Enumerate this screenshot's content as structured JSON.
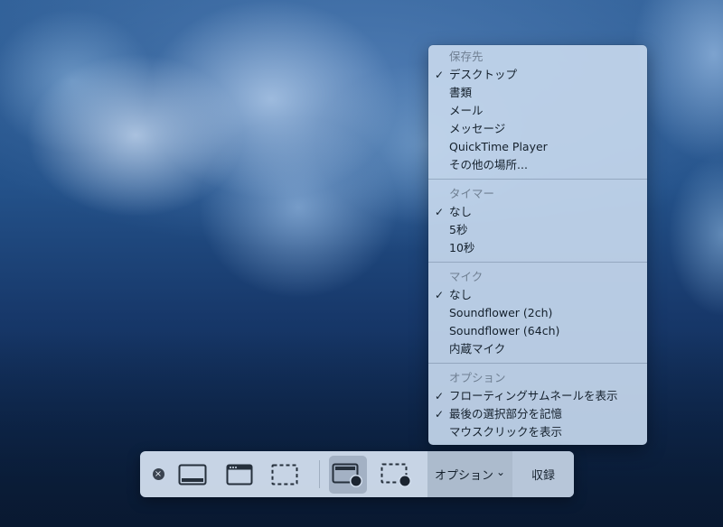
{
  "options_menu": {
    "save_to": {
      "header": "保存先",
      "items": [
        {
          "label": "デスクトップ",
          "checked": true
        },
        {
          "label": "書類",
          "checked": false
        },
        {
          "label": "メール",
          "checked": false
        },
        {
          "label": "メッセージ",
          "checked": false
        },
        {
          "label": "QuickTime Player",
          "checked": false
        },
        {
          "label": "その他の場所...",
          "checked": false
        }
      ]
    },
    "timer": {
      "header": "タイマー",
      "items": [
        {
          "label": "なし",
          "checked": true
        },
        {
          "label": "5秒",
          "checked": false
        },
        {
          "label": "10秒",
          "checked": false
        }
      ]
    },
    "microphone": {
      "header": "マイク",
      "items": [
        {
          "label": "なし",
          "checked": true
        },
        {
          "label": "Soundflower (2ch)",
          "checked": false
        },
        {
          "label": "Soundflower (64ch)",
          "checked": false
        },
        {
          "label": "内蔵マイク",
          "checked": false
        }
      ]
    },
    "options": {
      "header": "オプション",
      "items": [
        {
          "label": "フローティングサムネールを表示",
          "checked": true
        },
        {
          "label": "最後の選択部分を記憶",
          "checked": true
        },
        {
          "label": "マウスクリックを表示",
          "checked": false
        }
      ]
    }
  },
  "toolbar": {
    "close_icon": "close-icon",
    "options_label": "オプション",
    "options_chevron": "⌄",
    "record_label": "収録",
    "selected_tool": "record-screen"
  },
  "glyphs": {
    "checkmark": "✓",
    "close": "×"
  }
}
